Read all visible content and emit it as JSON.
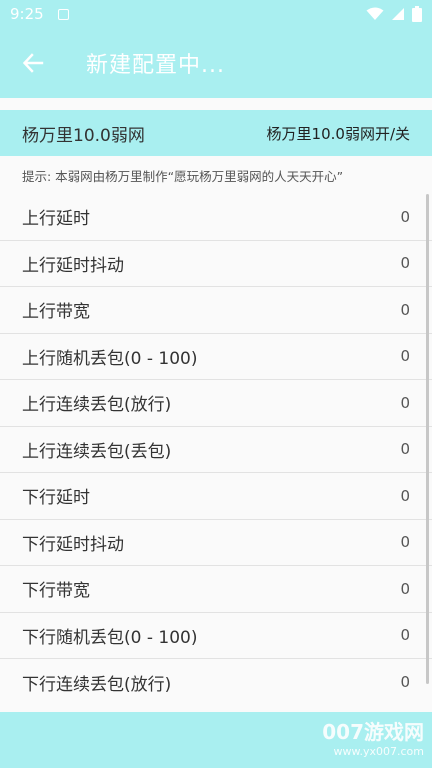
{
  "status_bar": {
    "time": "9:25",
    "icons": [
      "notification-icon",
      "wifi-icon",
      "signal-icon",
      "battery-icon"
    ]
  },
  "app_bar": {
    "title": "新建配置中...",
    "back_icon": "arrow-left-icon"
  },
  "profile": {
    "name": "杨万里10.0弱网",
    "toggle_label": "杨万里10.0弱网开/关"
  },
  "tip": "提示: 本弱网由杨万里制作“愿玩杨万里弱网的人天天开心”",
  "settings": [
    {
      "label": "上行延时",
      "value": "0"
    },
    {
      "label": "上行延时抖动",
      "value": "0"
    },
    {
      "label": "上行带宽",
      "value": "0"
    },
    {
      "label": "上行随机丢包(0 - 100)",
      "value": "0"
    },
    {
      "label": "上行连续丢包(放行)",
      "value": "0"
    },
    {
      "label": "上行连续丢包(丢包)",
      "value": "0"
    },
    {
      "label": "下行延时",
      "value": "0"
    },
    {
      "label": "下行延时抖动",
      "value": "0"
    },
    {
      "label": "下行带宽",
      "value": "0"
    },
    {
      "label": "下行随机丢包(0 - 100)",
      "value": "0"
    },
    {
      "label": "下行连续丢包(放行)",
      "value": "0"
    }
  ],
  "watermark": {
    "main": "007游戏网",
    "sub": "www.yx007.com"
  },
  "colors": {
    "accent": "#a9eff0",
    "background": "#fafafa",
    "divider": "#e2e2e2"
  }
}
